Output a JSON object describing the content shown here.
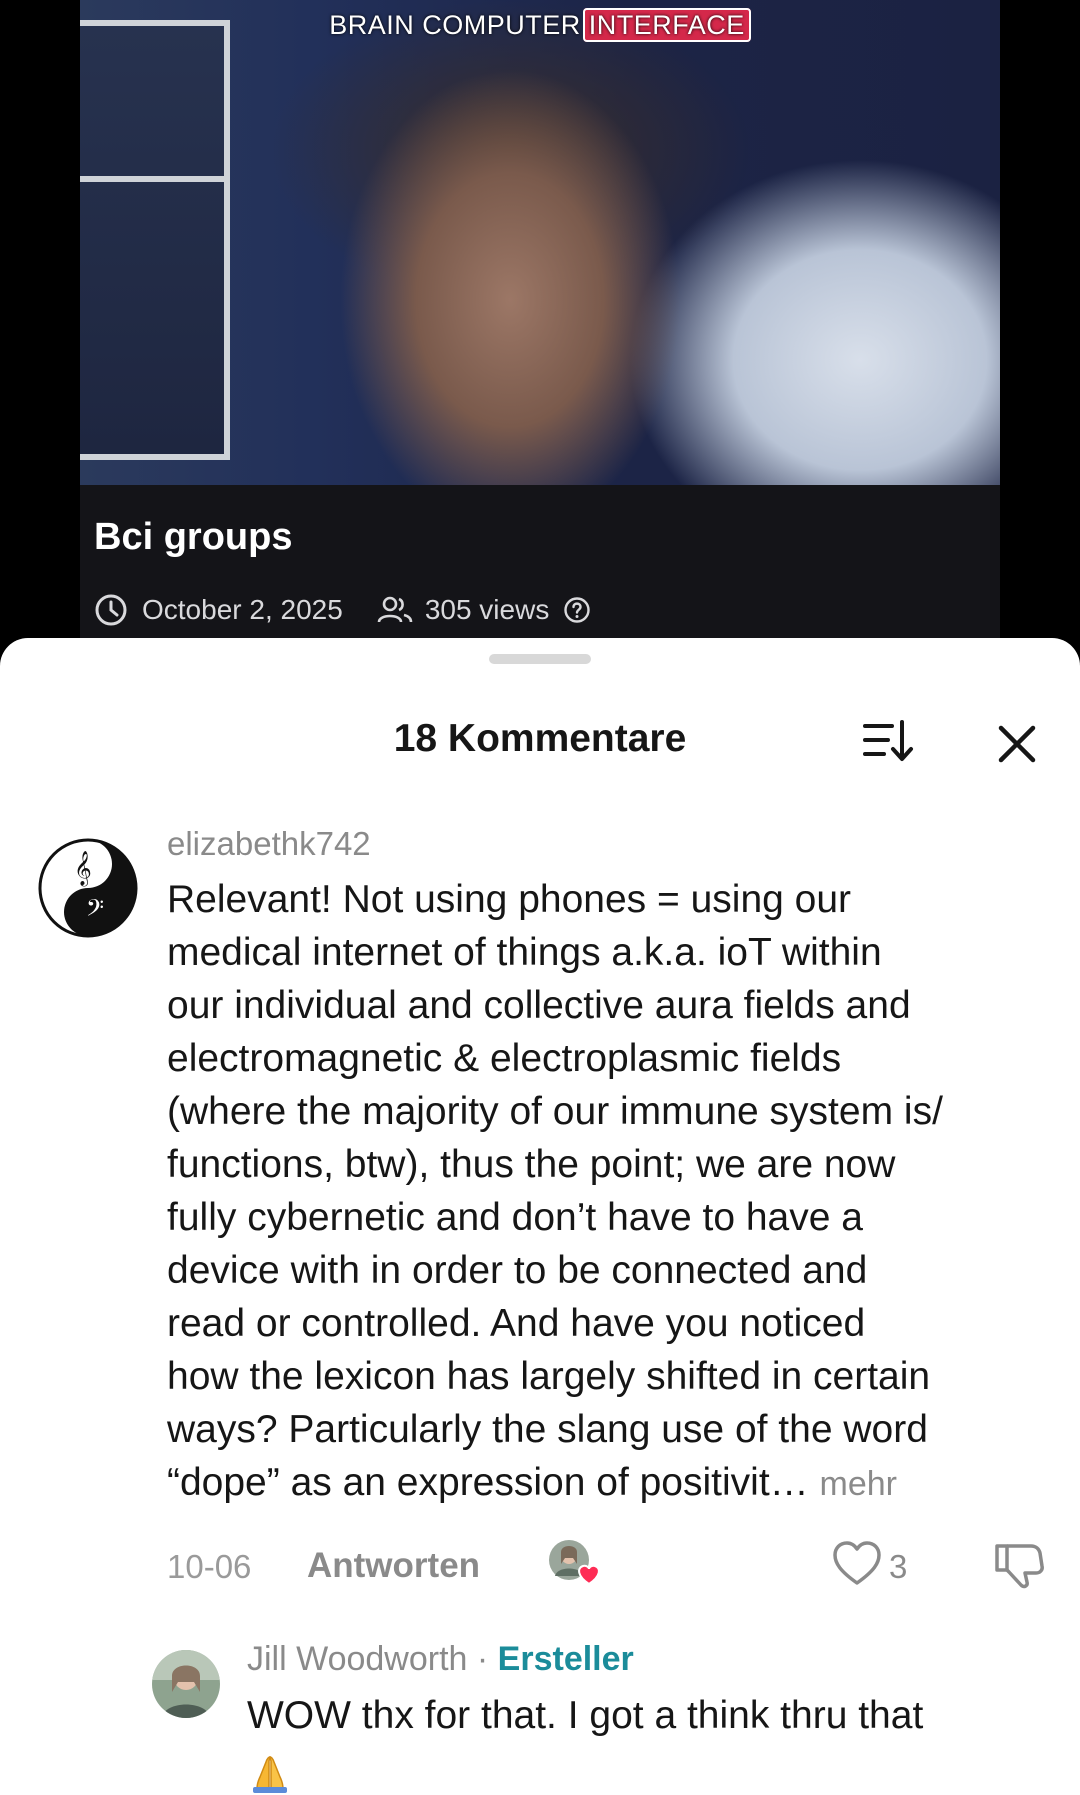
{
  "video": {
    "overlay_title_part1": "BRAIN COMPUTER",
    "overlay_title_part2": "INTERFACE",
    "title": "Bci groups",
    "date": "October 2, 2025",
    "views": "305 views",
    "icons": [
      "clock-icon",
      "people-icon",
      "help-icon"
    ]
  },
  "comments_sheet": {
    "title": "18 Kommentare",
    "sort_icon": "sort-icon",
    "close_icon": "close-icon",
    "comment": {
      "username": "elizabethk742",
      "lines": [
        "Relevant! Not using phones = using our",
        "medical internet of things a.k.a. ioT within",
        "our individual and collective aura fields and",
        "electromagnetic & electroplasmic fields",
        "(where the majority of our immune system is/",
        "functions, btw), thus the point; we are now",
        "fully cybernetic and don’t have to have a",
        "device with in order to be connected and",
        "read or controlled. And have you noticed",
        "how the lexicon has largely shifted in certain",
        "ways? Particularly the slang use of the word",
        "“dope” as an expression of positivit…"
      ],
      "more_label": "mehr",
      "date": "10-06",
      "reply_label": "Antworten",
      "like_count": "3",
      "like_color": "#fe2c55"
    },
    "reply": {
      "username": "Jill Woodworth",
      "separator": " · ",
      "badge": "Ersteller",
      "badge_color": "#1b8c9a",
      "text": "WOW thx for that. I got a think thru that",
      "emoji": "folded-hands-emoji"
    }
  }
}
